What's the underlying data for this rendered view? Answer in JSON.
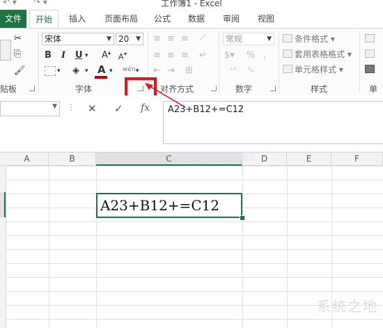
{
  "window": {
    "title": "工作簿1 - Excel"
  },
  "tabs": [
    {
      "label": "文件",
      "active": false
    },
    {
      "label": "开始",
      "active": true
    },
    {
      "label": "插入",
      "active": false
    },
    {
      "label": "页面布局",
      "active": false
    },
    {
      "label": "公式",
      "active": false
    },
    {
      "label": "数据",
      "active": false
    },
    {
      "label": "审阅",
      "active": false
    },
    {
      "label": "视图",
      "active": false
    }
  ],
  "ribbon": {
    "clipboard": {
      "label": "贴板"
    },
    "font": {
      "label": "字体",
      "font_name": "宋体",
      "font_size": "20",
      "bold": "B",
      "italic": "I",
      "underline": "U",
      "grow": "A",
      "shrink": "A",
      "font_color_glyph": "A",
      "font_color": "#c00000"
    },
    "alignment": {
      "label": "对齐方式",
      "phonetic": "wén"
    },
    "number": {
      "label": "数字",
      "format": "常规",
      "percent": "%",
      "comma": ","
    },
    "styles": {
      "label": "样式",
      "conditional": "条件格式",
      "table": "套用表格格式",
      "cell_styles": "单元格样式"
    },
    "cells": {
      "label": "单元"
    }
  },
  "formula_bar": {
    "cancel": "✕",
    "enter": "✓",
    "fx": "fx",
    "content": "A23+B12+=C12"
  },
  "columns": [
    "A",
    "B",
    "C",
    "D",
    "E",
    "F"
  ],
  "active_cell": {
    "text": "A23+B12+=C12"
  },
  "watermarks": {
    "site": "www.pHome.NET",
    "brand": "系统之地"
  },
  "colors": {
    "accent": "#217346",
    "highlight": "#e3141c"
  }
}
